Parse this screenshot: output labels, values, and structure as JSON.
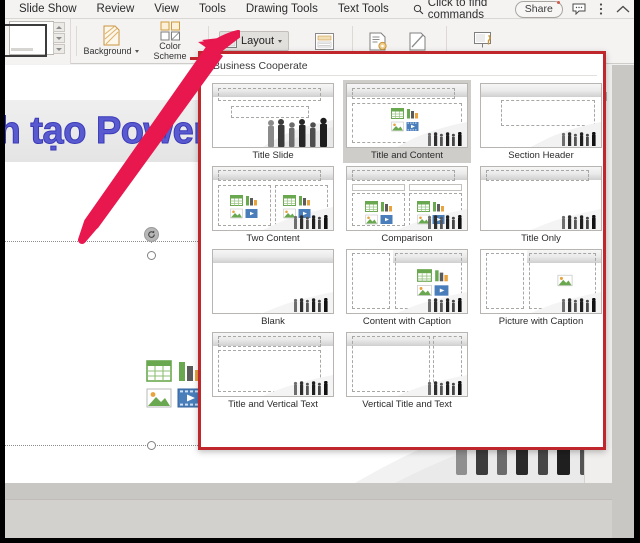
{
  "menubar": {
    "items": [
      "Slide Show",
      "Review",
      "View",
      "Tools",
      "Drawing Tools",
      "Text Tools"
    ],
    "search_placeholder": "Click to find commands",
    "share_label": "Share",
    "icons": [
      "search-icon",
      "comment-icon",
      "more-options-icon",
      "collapse-ribbon-icon"
    ]
  },
  "ribbon": {
    "background_label": "Background",
    "color_scheme_label": "Color\nScheme",
    "layout_label": "Layout",
    "icons": [
      "background-icon",
      "color-scheme-icon",
      "layout-icon",
      "slide-size-icon",
      "header-footer-icon",
      "hide-slide-icon",
      "presenter-view-icon"
    ]
  },
  "gallery": {
    "header": "Business Cooperate",
    "selected": "Title and Content",
    "border_color": "#c0272d",
    "rows": [
      [
        {
          "label": "Title Slide",
          "kind": "title-slide",
          "selected": false
        },
        {
          "label": "Title and Content",
          "kind": "title-content",
          "selected": true
        },
        {
          "label": "Section Header",
          "kind": "section-header",
          "selected": false
        }
      ],
      [
        {
          "label": "Two Content",
          "kind": "two-content",
          "selected": false
        },
        {
          "label": "Comparison",
          "kind": "comparison",
          "selected": false
        },
        {
          "label": "Title Only",
          "kind": "title-only",
          "selected": false
        }
      ],
      [
        {
          "label": "Blank",
          "kind": "blank",
          "selected": false
        },
        {
          "label": "Content with Caption",
          "kind": "content-caption",
          "selected": false
        },
        {
          "label": "Picture with Caption",
          "kind": "picture-caption",
          "selected": false
        }
      ],
      [
        {
          "label": "Title and Vertical Text",
          "kind": "title-vertical-text",
          "selected": false
        },
        {
          "label": "Vertical Title and Text",
          "kind": "vertical-title-text",
          "selected": false
        },
        {
          "label": "",
          "kind": "empty",
          "selected": false
        }
      ]
    ]
  },
  "slide": {
    "title_text": "ch tạo PowerP",
    "title_color": "#5a5ad0",
    "placeholder_icons": [
      "table-icon",
      "chart-icon",
      "picture-icon",
      "video-icon"
    ]
  },
  "canvas_tools": {
    "icons": [
      "duplicate-slide-icon",
      "weather-effect-icon",
      "settings-sliders-icon",
      "history-icon"
    ]
  },
  "annotation": {
    "arrow_color": "#e8174e",
    "callout_color": "#c0272d"
  }
}
